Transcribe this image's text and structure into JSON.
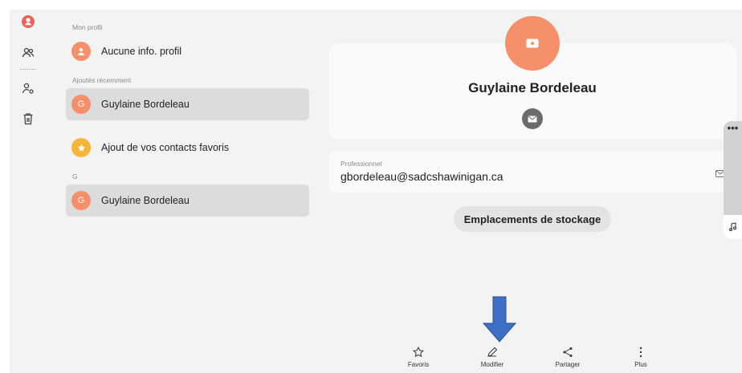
{
  "rail": {
    "items": [
      {
        "icon": "profile-icon",
        "color": "#e8645a"
      },
      {
        "icon": "contacts-icon"
      },
      {
        "icon": "manage-contacts-icon"
      },
      {
        "icon": "trash-icon"
      }
    ]
  },
  "list": {
    "my_profile_section": "Mon profil",
    "my_profile_label": "Aucune info. profil",
    "recent_section": "Ajoutés récemment",
    "recent_contact": {
      "initial": "G",
      "name": "Guylaine Bordeleau"
    },
    "favorites_label": "Ajout de vos contacts favoris",
    "letter_section": "G",
    "letter_contact": {
      "initial": "G",
      "name": "Guylaine Bordeleau"
    }
  },
  "detail": {
    "name": "Guylaine Bordeleau",
    "email_type": "Professionnel",
    "email": "gbordeleau@sadcshawinigan.ca",
    "storage_button": "Emplacements de stockage",
    "side_handle_menu": "•••"
  },
  "bottom_bar": {
    "favorites": "Favoris",
    "edit": "Modifier",
    "share": "Partager",
    "more": "Plus"
  },
  "colors": {
    "avatar_orange": "#f6906b",
    "favorite_yellow": "#f5b63a",
    "arrow_blue": "#3d6fc4"
  }
}
